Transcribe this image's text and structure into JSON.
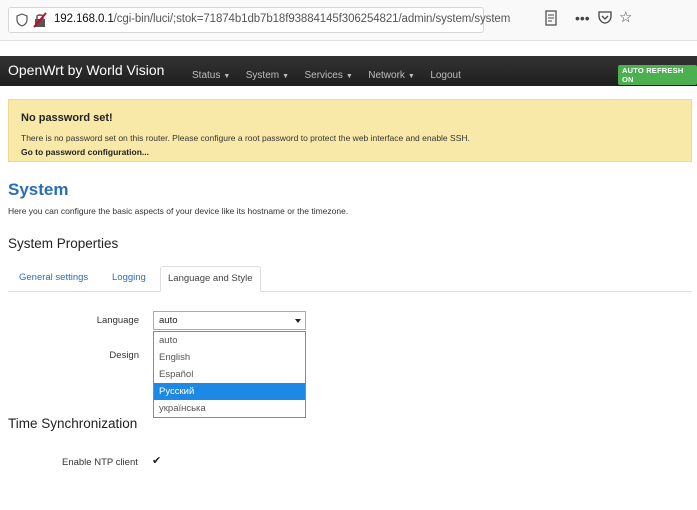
{
  "browser": {
    "url_host": "192.168.0.1",
    "url_path": "/cgi-bin/luci/;stok=71874b1db7b18f93884145f306254821/admin/system/system"
  },
  "header": {
    "brand": "OpenWrt by World Vision",
    "nav": [
      {
        "label": "Status"
      },
      {
        "label": "System"
      },
      {
        "label": "Services"
      },
      {
        "label": "Network"
      },
      {
        "label": "Logout"
      }
    ],
    "autorefresh": "AUTO REFRESH ON",
    "autorefresh_color": "#4caf50"
  },
  "warning": {
    "title": "No password set!",
    "text": "There is no password set on this router. Please configure a root password to protect the web interface and enable SSH.",
    "link": "Go to password configuration..."
  },
  "page": {
    "title": "System",
    "description": "Here you can configure the basic aspects of your device like its hostname or the timezone.",
    "section_title": "System Properties"
  },
  "tabs": [
    {
      "label": "General settings"
    },
    {
      "label": "Logging"
    },
    {
      "label": "Language and Style"
    }
  ],
  "form": {
    "language_label": "Language",
    "language_value": "auto",
    "design_label": "Design",
    "language_options": [
      "auto",
      "English",
      "Español",
      "Русский",
      "українська"
    ],
    "selected_option": "Русский"
  },
  "time_sync": {
    "title": "Time Synchronization",
    "ntp_label": "Enable NTP client",
    "ntp_checked": "✔"
  },
  "colors": {
    "accent": "#2a6eb8",
    "warning_bg": "#f9e9a8",
    "selection": "#1e88e5"
  }
}
